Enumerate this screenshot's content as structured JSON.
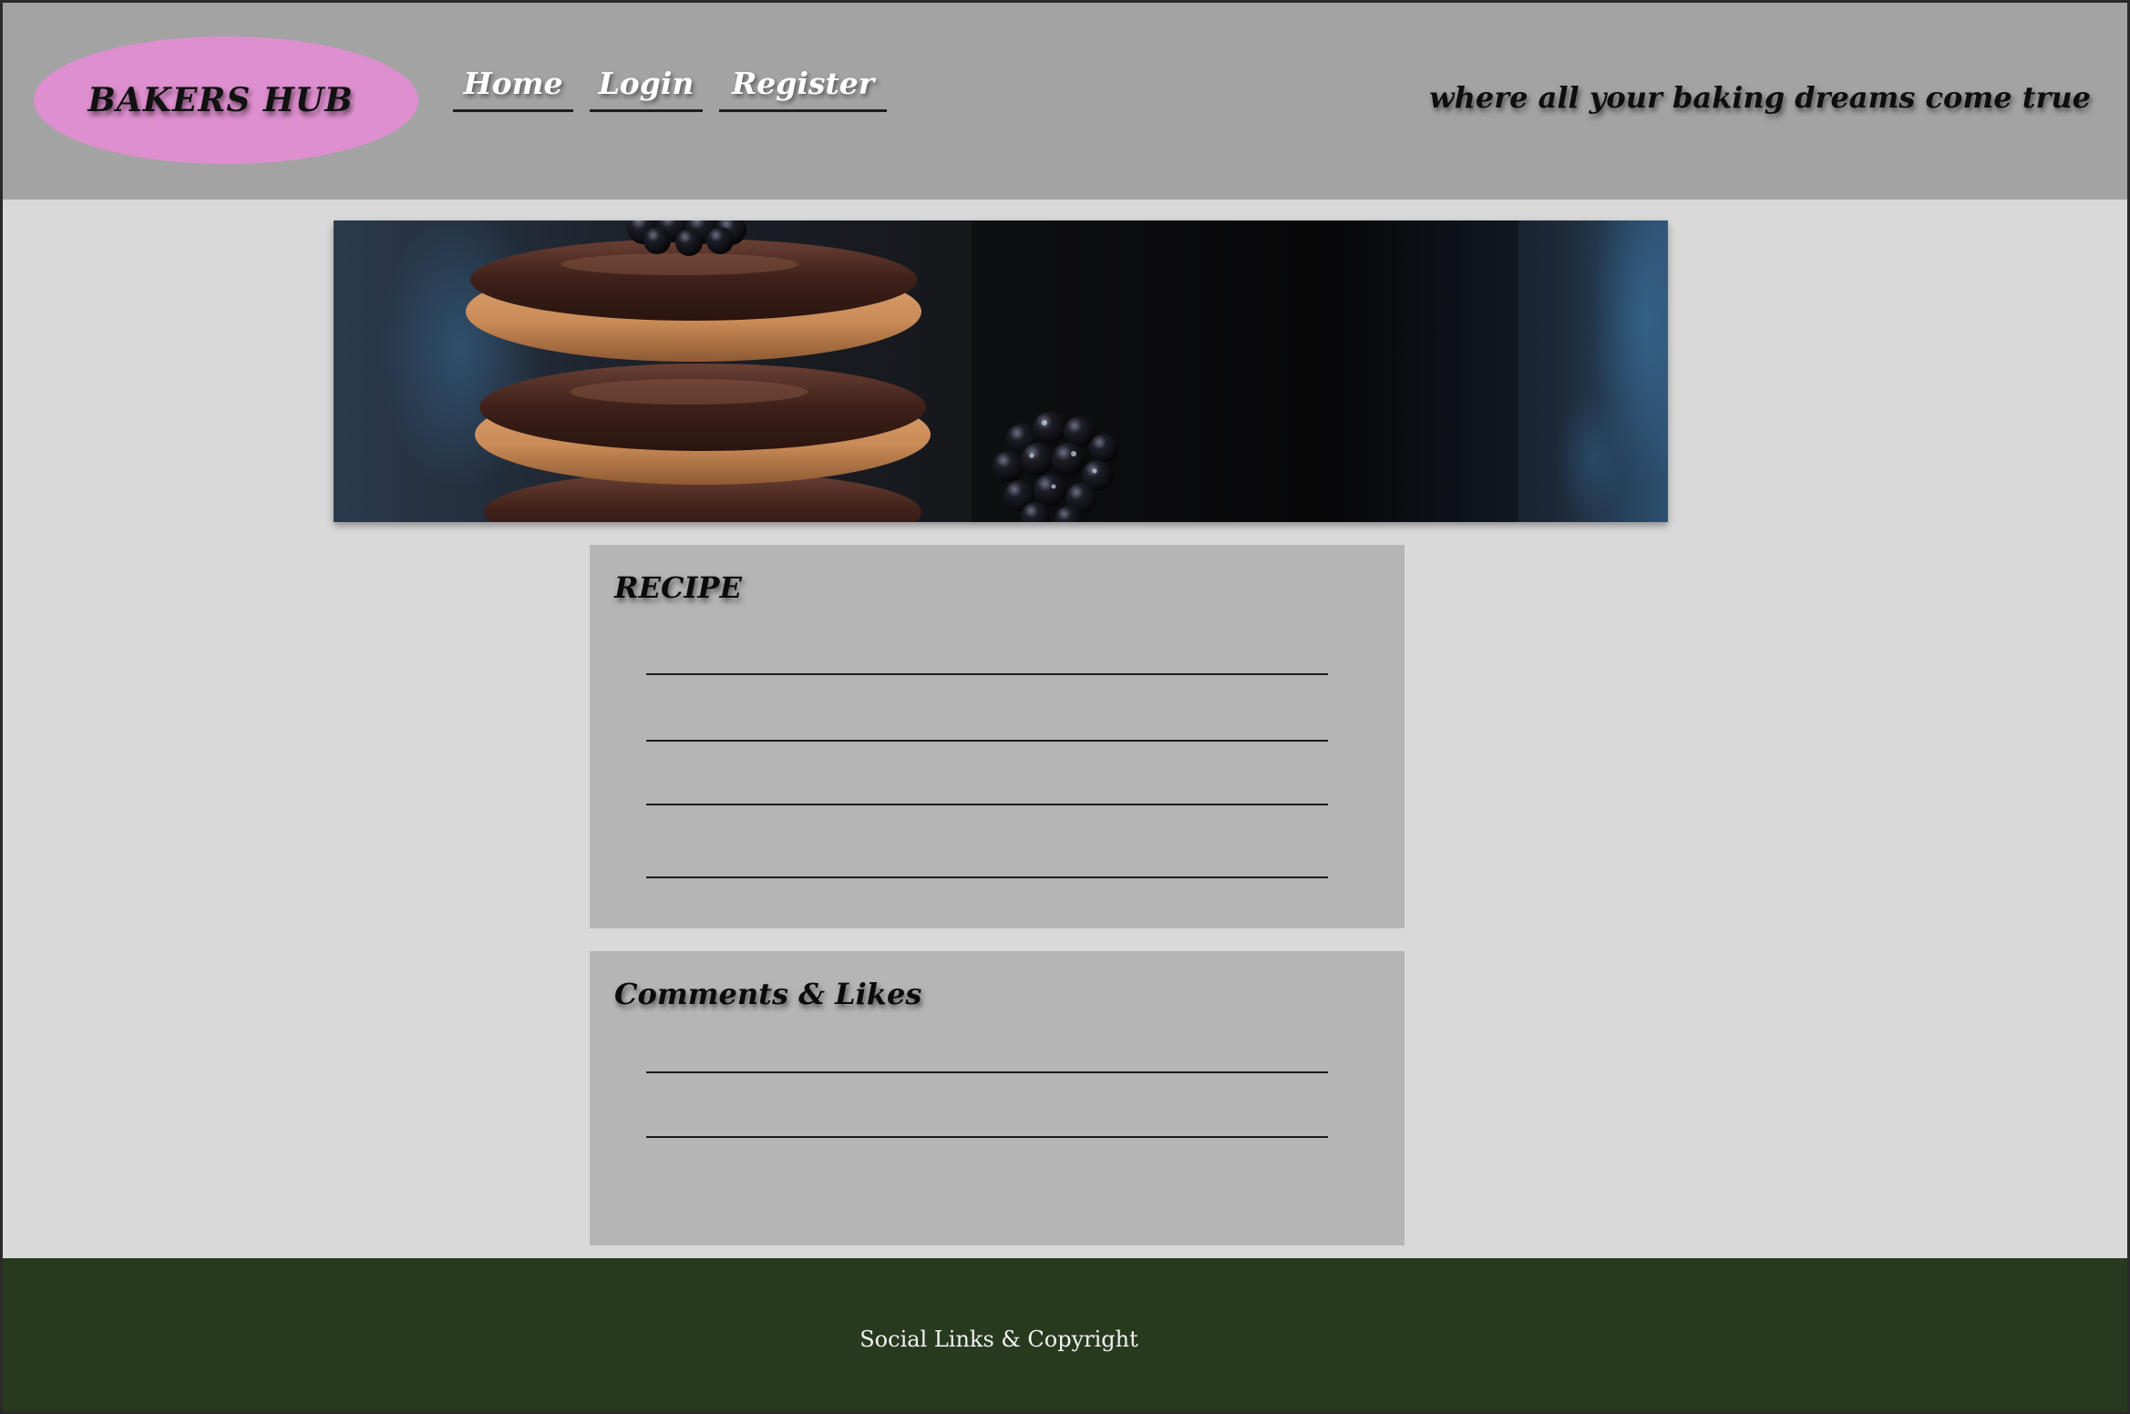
{
  "header": {
    "logo_text": "BAKERS HUB",
    "tagline": "where all your baking dreams come true",
    "nav": [
      {
        "label": "Home"
      },
      {
        "label": "Login"
      },
      {
        "label": "Register"
      }
    ]
  },
  "hero": {
    "alt": "Chocolate-topped cookies stacked with blackberries"
  },
  "recipe_card": {
    "title": "RECIPE"
  },
  "comments_card": {
    "title": "Comments & Likes"
  },
  "footer": {
    "text": "Social Links & Copyright"
  },
  "colors": {
    "header_bg": "#a3a3a3",
    "logo_bg": "#de8fcf",
    "page_bg": "#d9d9d9",
    "card_bg": "#b5b5b5",
    "footer_bg": "#283a1e"
  }
}
